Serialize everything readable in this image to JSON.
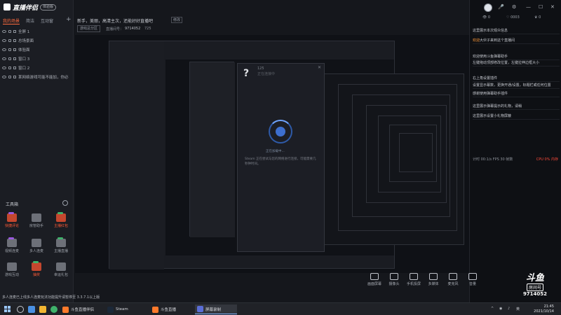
{
  "app": {
    "name": "直播伴侣",
    "badge": "体验版"
  },
  "sidebar": {
    "tabs": [
      "我的场景",
      "简洁",
      "互动窗"
    ],
    "active_tab": 0,
    "scenes": [
      {
        "label": "全屏 1"
      },
      {
        "label": "总场景面"
      },
      {
        "label": "体验面"
      },
      {
        "label": "窗口 3"
      },
      {
        "label": "窗口 2"
      },
      {
        "label": "某网络游戏可能不能加，你必"
      }
    ],
    "tools_title": "工具箱",
    "tools": [
      {
        "label": "快捷评论",
        "icon": "gift-icon",
        "hot": true
      },
      {
        "label": "房管助手",
        "icon": "shield-icon",
        "hot": false
      },
      {
        "label": "主播红包",
        "icon": "redpacket-icon",
        "hot": true
      },
      {
        "label": "视频连麦",
        "icon": "video-link-icon",
        "hot": false
      },
      {
        "label": "多人连麦",
        "icon": "multi-link-icon",
        "hot": false
      },
      {
        "label": "主播直播",
        "icon": "live-icon",
        "hot": false
      },
      {
        "label": "游戏互动",
        "icon": "game-icon",
        "hot": false
      },
      {
        "label": "抽奖",
        "icon": "lottery-icon",
        "hot": true
      },
      {
        "label": "幸运礼包",
        "icon": "lucky-icon",
        "hot": false
      }
    ]
  },
  "topbar": {
    "title": "新手，美丽，高清主次，还能好好直播吧",
    "edit_label": "修改",
    "category": "游戏总分区",
    "room_label": "直播间号：",
    "room_number": "9714052",
    "heat": "725"
  },
  "dialog": {
    "question": "?",
    "title": "125",
    "subtitle": "正在连接中",
    "close": "✕",
    "wait_text": "正在加载中...",
    "description": "Steam 正在尝试与您的网络进行连接，可能需要几秒钟时间。"
  },
  "right_panel": {
    "controls": [
      "🎤",
      "⚙",
      "—",
      "☐",
      "✕"
    ],
    "stats": [
      "👁 0",
      "♡ 0003",
      "♛ 0"
    ],
    "chat": [
      {
        "name": "",
        "text": "这里展示本次观众信息"
      },
      {
        "name": "欢迎",
        "text": "大伙子来到这个直播间"
      },
      {
        "name": "",
        "text": "欢迎使用斗鱼弹幕助手"
      },
      {
        "name": "",
        "text": "左键拖动顶部修改位置，左键拉伸边框大小"
      },
      {
        "name": "",
        "text": "右上角设置插件"
      },
      {
        "name": "",
        "text": "设置显示幕数，更换开通/设置，标题栏或任何位置"
      },
      {
        "name": "",
        "text": "感谢使用弹幕助手插件"
      },
      {
        "name": "",
        "text": "这里展示弹幕提示的礼物，请稍"
      },
      {
        "name": "",
        "text": "这里展示设置小礼物屏蔽"
      }
    ],
    "mini_stats": {
      "left": "计时 00:1/s  FPS 30  帧数",
      "right": "CPU 0%  内存"
    }
  },
  "controls": [
    {
      "label": "画面屏幕",
      "icon": "screen-icon"
    },
    {
      "label": "摄像头",
      "icon": "camera-icon"
    },
    {
      "label": "手机投屏",
      "icon": "phone-icon"
    },
    {
      "label": "多媒体",
      "icon": "media-icon"
    },
    {
      "label": "麦克风",
      "icon": "mic-icon"
    },
    {
      "label": "音量",
      "icon": "volume-icon"
    }
  ],
  "brand": {
    "logo": "斗鱼",
    "room_label": "房间号",
    "room_number": "9714052"
  },
  "status_strip": "多人连麦已上线多人连麦玩法功能提升请暂停至 3.3.7.1以上版",
  "taskbar": {
    "tasks": [
      {
        "label": "斗鱼直播伴侣"
      },
      {
        "label": "Steam"
      },
      {
        "label": "斗鱼直播"
      },
      {
        "label": "屏幕录制"
      }
    ],
    "active_task": 3,
    "time": "21:45",
    "date": "2021/10/14",
    "ime": "英"
  },
  "colors": {
    "accent": "#ff6b3d",
    "hot_tool": "#c4472e",
    "background": "#15171c"
  }
}
